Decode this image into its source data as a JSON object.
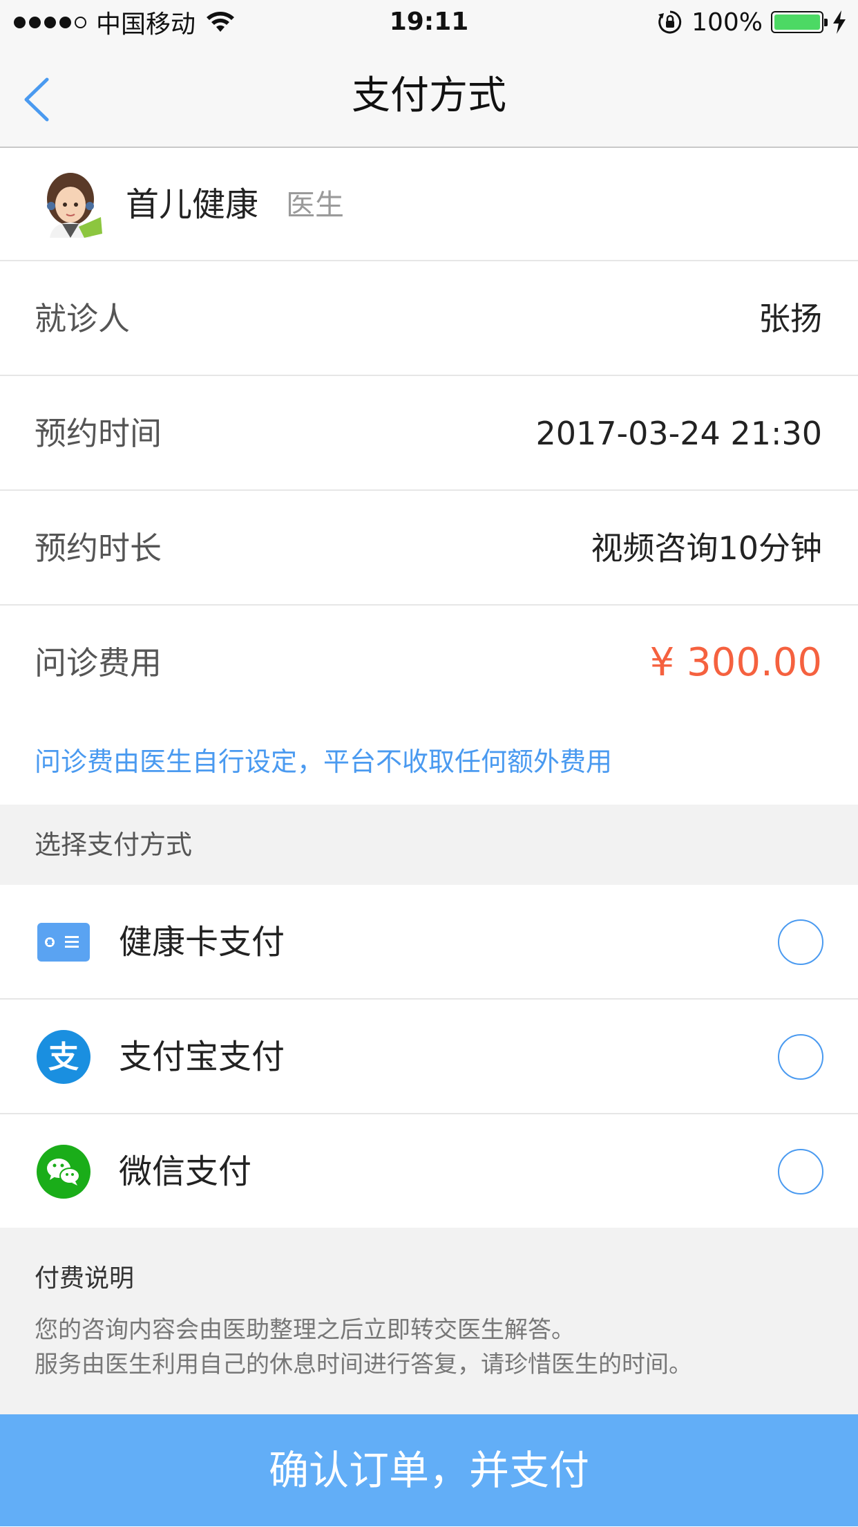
{
  "status_bar": {
    "carrier": "中国移动",
    "time": "19:11",
    "battery_percent": "100%"
  },
  "nav": {
    "title": "支付方式",
    "back_icon": "chevron-left-icon"
  },
  "doctor": {
    "name": "首儿健康",
    "role": "医生"
  },
  "info_rows": [
    {
      "label": "就诊人",
      "value": "张扬"
    },
    {
      "label": "预约时间",
      "value": "2017-03-24 21:30"
    },
    {
      "label": "预约时长",
      "value": "视频咨询10分钟"
    },
    {
      "label": "问诊费用",
      "value": "¥ 300.00"
    }
  ],
  "notice": "问诊费由医生自行设定，平台不收取任何额外费用",
  "payment_section_title": "选择支付方式",
  "payment_methods": [
    {
      "label": "健康卡支付",
      "icon": "health-card-icon"
    },
    {
      "label": "支付宝支付",
      "icon": "alipay-icon"
    },
    {
      "label": "微信支付",
      "icon": "wechat-icon"
    }
  ],
  "fee_explanation": {
    "title": "付费说明",
    "lines": [
      "您的咨询内容会由医助整理之后立即转交医生解答。",
      "服务由医生利用自己的休息时间进行答复，请珍惜医生的时间。"
    ]
  },
  "confirm_button": "确认订单，并支付",
  "colors": {
    "accent_blue": "#4a9af0",
    "button_blue": "#62aef7",
    "price_red": "#f5613f"
  }
}
